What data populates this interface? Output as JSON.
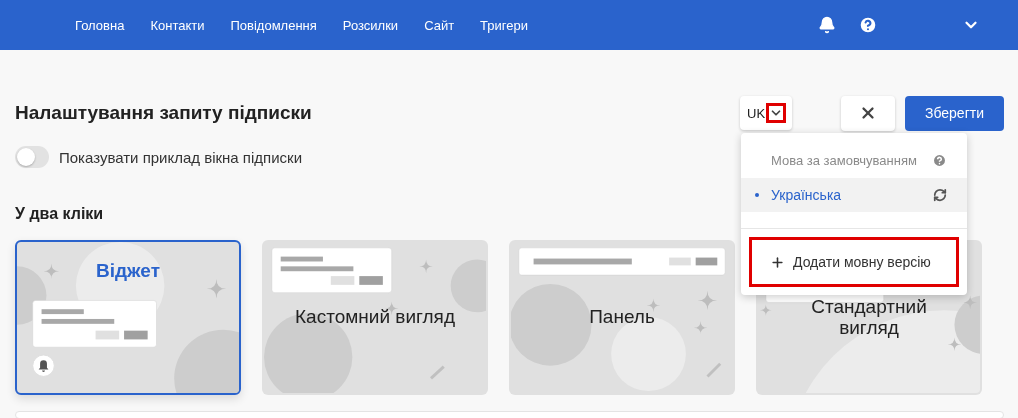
{
  "nav": {
    "items": [
      "Головна",
      "Контакти",
      "Повідомлення",
      "Розсилки",
      "Сайт",
      "Тригери"
    ]
  },
  "header": {
    "title": "Налаштування запиту підписки",
    "language": {
      "code": "UK",
      "expanded": true,
      "highlighted": true
    },
    "save": "Зберегти"
  },
  "preview_toggle": {
    "label": "Показувати приклад вікна підписки",
    "on": false
  },
  "section": {
    "title": "У два кліки",
    "cards": [
      {
        "kind": "widget",
        "label": "Віджет",
        "selected": true
      },
      {
        "kind": "custom",
        "label": "Кастомний вигляд",
        "selected": false
      },
      {
        "kind": "panel",
        "label": "Панель",
        "selected": false
      },
      {
        "kind": "standard",
        "label": "Стандартний вигляд",
        "selected": false
      }
    ]
  },
  "language_menu": {
    "header": "Мова за замовчуванням",
    "languages": [
      {
        "label": "Українська",
        "selected": true
      }
    ],
    "add": {
      "label": "Додати мовну версію",
      "highlighted": true
    }
  }
}
